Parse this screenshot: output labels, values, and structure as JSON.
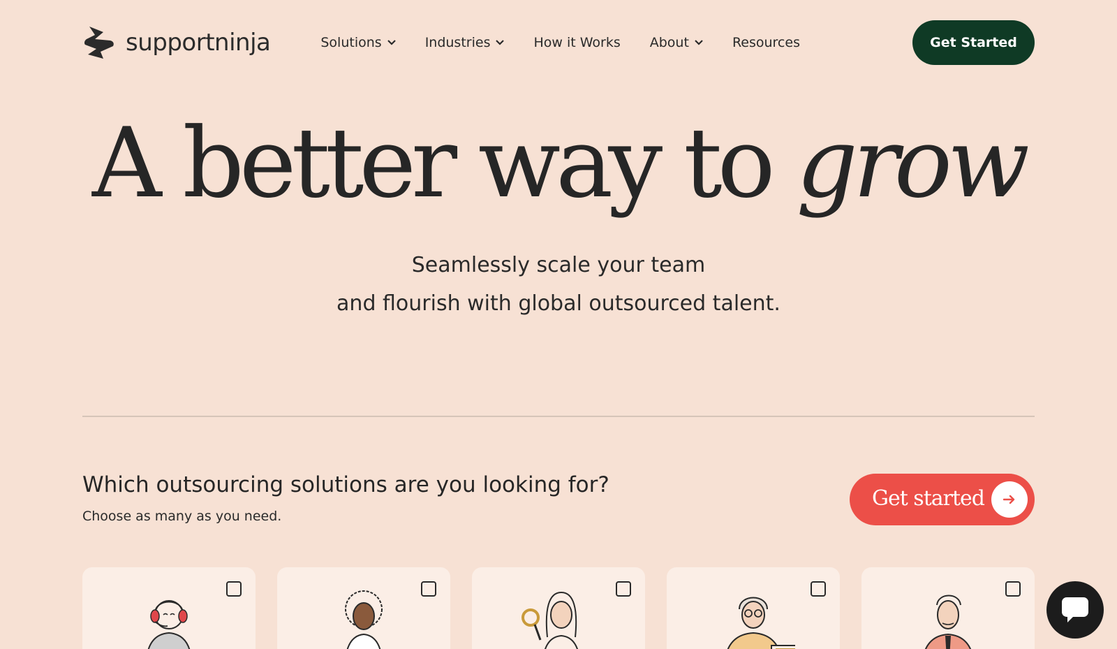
{
  "header": {
    "logo_text": "supportninja",
    "nav": [
      {
        "label": "Solutions",
        "has_dropdown": true
      },
      {
        "label": "Industries",
        "has_dropdown": true
      },
      {
        "label": "How it Works",
        "has_dropdown": false
      },
      {
        "label": "About",
        "has_dropdown": true
      },
      {
        "label": "Resources",
        "has_dropdown": false
      }
    ],
    "cta_label": "Get Started"
  },
  "hero": {
    "title_main": "A better way to ",
    "title_italic": "grow",
    "subtitle_line1": "Seamlessly scale your team",
    "subtitle_line2": "and flourish with global outsourced talent."
  },
  "solutions": {
    "question": "Which outsourcing solutions are you looking for?",
    "hint": "Choose as many as you need.",
    "cta_label": "Get started",
    "cards": [
      {
        "icon": "headset-agent-icon",
        "checked": false
      },
      {
        "icon": "curly-hair-person-icon",
        "checked": false
      },
      {
        "icon": "magnifier-person-icon",
        "checked": false
      },
      {
        "icon": "glasses-person-icon",
        "checked": false
      },
      {
        "icon": "tie-person-icon",
        "checked": false
      }
    ]
  },
  "colors": {
    "background": "#f7e1d4",
    "dark_button": "#0f3a25",
    "red_button": "#ec4f48",
    "card": "#fbeee6",
    "text": "#2a2a2a"
  }
}
